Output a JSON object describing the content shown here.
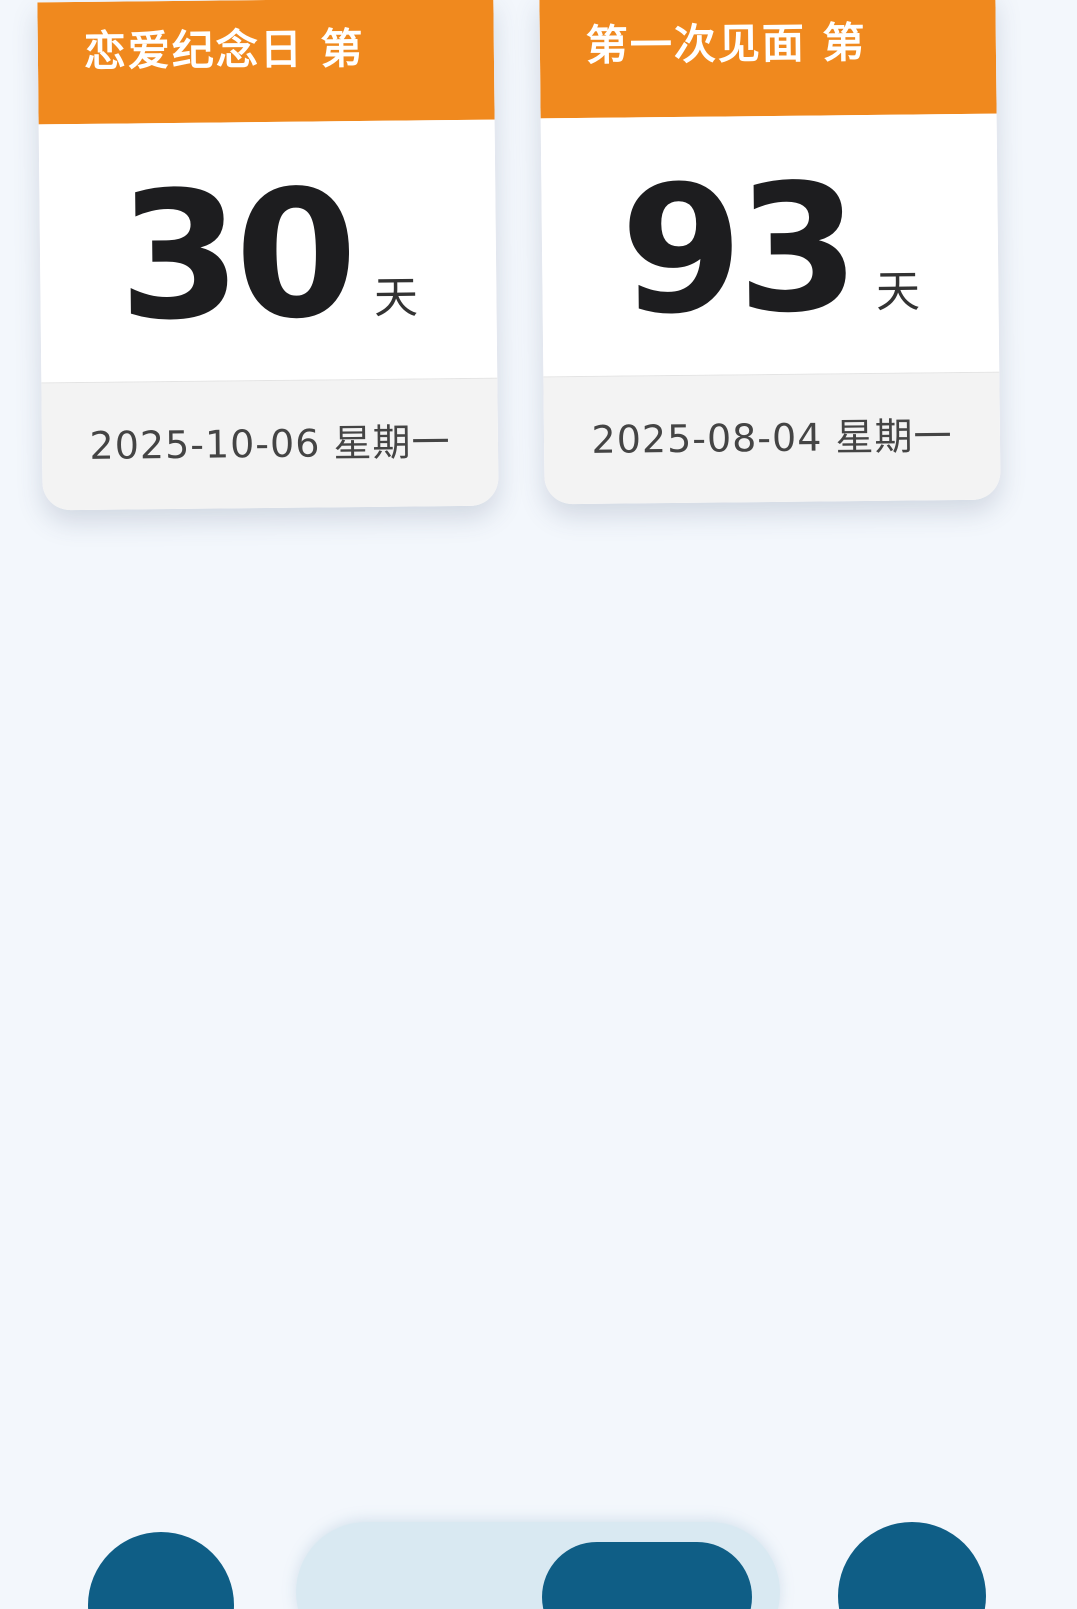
{
  "cards": [
    {
      "title": "恋爱纪念日 第",
      "count": "30",
      "unit": "天",
      "date": "2025-10-06 星期一"
    },
    {
      "title": "第一次见面 第",
      "count": "93",
      "unit": "天",
      "date": "2025-08-04 星期一"
    }
  ],
  "colors": {
    "header": "#f0891e",
    "background": "#f3f7fc",
    "nav_primary": "#0f5e86",
    "nav_surface": "#d9e9f2"
  },
  "icons": {
    "nav_left": "nav-left-icon",
    "nav_center": "nav-center-icon",
    "nav_right": "nav-right-icon"
  }
}
